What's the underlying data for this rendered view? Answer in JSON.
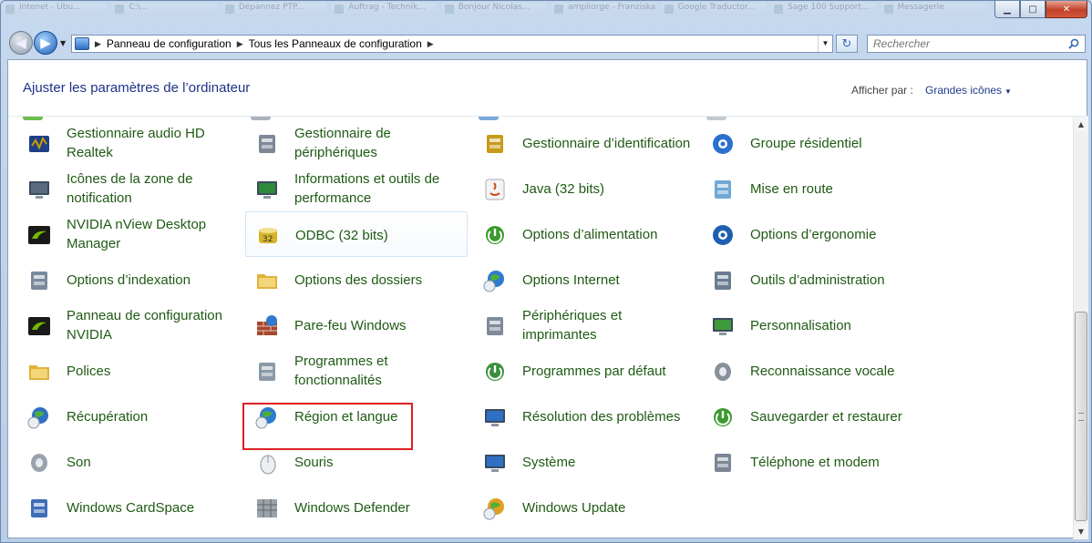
{
  "titlebar": {
    "tab_ghosts": [
      "Intenet - Ubu...",
      "C:\\...",
      "Dépannez PTP...",
      "Auftrag - Technik...",
      "Bonjour Nicolas...",
      "ampliorge - Franziska...",
      "Google Traductor...",
      "Sage 100 Support...",
      "Messagerie"
    ],
    "minimize": "▁",
    "maximize": "□",
    "close": "✕"
  },
  "navbar": {
    "back": "◀",
    "forward": "▶",
    "history_dd": "▼",
    "breadcrumb": [
      "Panneau de configuration",
      "Tous les Panneaux de configuration"
    ],
    "breadcrumb_sep": "▶",
    "address_dd": "▼",
    "refresh": "↻",
    "search_placeholder": "Rechercher"
  },
  "header": {
    "title": "Ajuster les paramètres de l’ordinateur",
    "view_label": "Afficher par :",
    "view_value": "Grandes icônes",
    "view_caret": "▼"
  },
  "items": [
    {
      "label": "Gestionnaire audio HD Realtek",
      "icon": "realtek-audio-icon",
      "color": "#c7a000"
    },
    {
      "label": "Gestionnaire de périphériques",
      "icon": "device-manager-icon",
      "color": "#7d8796"
    },
    {
      "label": "Gestionnaire d’identification",
      "icon": "credential-manager-icon",
      "color": "#c89a1a"
    },
    {
      "label": "Groupe résidentiel",
      "icon": "homegroup-icon",
      "color": "#2b6fd0"
    },
    {
      "label": "Icônes de la zone de notification",
      "icon": "notification-area-icon",
      "color": "#5a6b80"
    },
    {
      "label": "Informations et outils de performance",
      "icon": "performance-icon",
      "color": "#2c8a3a"
    },
    {
      "label": "Java (32 bits)",
      "icon": "java-icon",
      "color": "#c94a1c"
    },
    {
      "label": "Mise en route",
      "icon": "getting-started-icon",
      "color": "#6fa8d6"
    },
    {
      "label": "NVIDIA nView Desktop Manager",
      "icon": "nvidia-nview-icon",
      "color": "#76b900"
    },
    {
      "label": "ODBC (32 bits)",
      "icon": "odbc-icon",
      "color": "#d6b52a"
    },
    {
      "label": "Options d’alimentation",
      "icon": "power-options-icon",
      "color": "#3c9a2e"
    },
    {
      "label": "Options d’ergonomie",
      "icon": "ease-of-access-icon",
      "color": "#1f5fb0"
    },
    {
      "label": "Options d’indexation",
      "icon": "indexing-options-icon",
      "color": "#7a8a9c"
    },
    {
      "label": "Options des dossiers",
      "icon": "folder-options-icon",
      "color": "#e0b23a"
    },
    {
      "label": "Options Internet",
      "icon": "internet-options-icon",
      "color": "#2f7bd0"
    },
    {
      "label": "Outils d’administration",
      "icon": "admin-tools-icon",
      "color": "#6a7c90"
    },
    {
      "label": "Panneau de configuration NVIDIA",
      "icon": "nvidia-control-panel-icon",
      "color": "#76b900"
    },
    {
      "label": "Pare-feu Windows",
      "icon": "windows-firewall-icon",
      "color": "#a6472c"
    },
    {
      "label": "Périphériques et imprimantes",
      "icon": "devices-printers-icon",
      "color": "#7f8b99"
    },
    {
      "label": "Personnalisation",
      "icon": "personalization-icon",
      "color": "#3f9a3a"
    },
    {
      "label": "Polices",
      "icon": "fonts-icon",
      "color": "#e0b23a"
    },
    {
      "label": "Programmes et fonctionnalités",
      "icon": "programs-features-icon",
      "color": "#8c9aa8"
    },
    {
      "label": "Programmes par défaut",
      "icon": "default-programs-icon",
      "color": "#3a8f3a"
    },
    {
      "label": "Reconnaissance vocale",
      "icon": "speech-recognition-icon",
      "color": "#8a9099"
    },
    {
      "label": "Récupération",
      "icon": "recovery-icon",
      "color": "#2f6fc4"
    },
    {
      "label": "Région et langue",
      "icon": "region-language-icon",
      "color": "#2f7bd0"
    },
    {
      "label": "Résolution des problèmes",
      "icon": "troubleshooting-icon",
      "color": "#2f6fc4"
    },
    {
      "label": "Sauvegarder et restaurer",
      "icon": "backup-restore-icon",
      "color": "#3c9a2e"
    },
    {
      "label": "Son",
      "icon": "sound-icon",
      "color": "#9aa3ad"
    },
    {
      "label": "Souris",
      "icon": "mouse-icon",
      "color": "#9aa3ad"
    },
    {
      "label": "Système",
      "icon": "system-icon",
      "color": "#2f6fc4"
    },
    {
      "label": "Téléphone et modem",
      "icon": "phone-modem-icon",
      "color": "#7b8794"
    },
    {
      "label": "Windows CardSpace",
      "icon": "cardspace-icon",
      "color": "#3d6fb8"
    },
    {
      "label": "Windows Defender",
      "icon": "windows-defender-icon",
      "color": "#707880"
    },
    {
      "label": "Windows Update",
      "icon": "windows-update-icon",
      "color": "#e0a020"
    }
  ],
  "scrollbar": {
    "up": "▲",
    "down": "▼"
  }
}
